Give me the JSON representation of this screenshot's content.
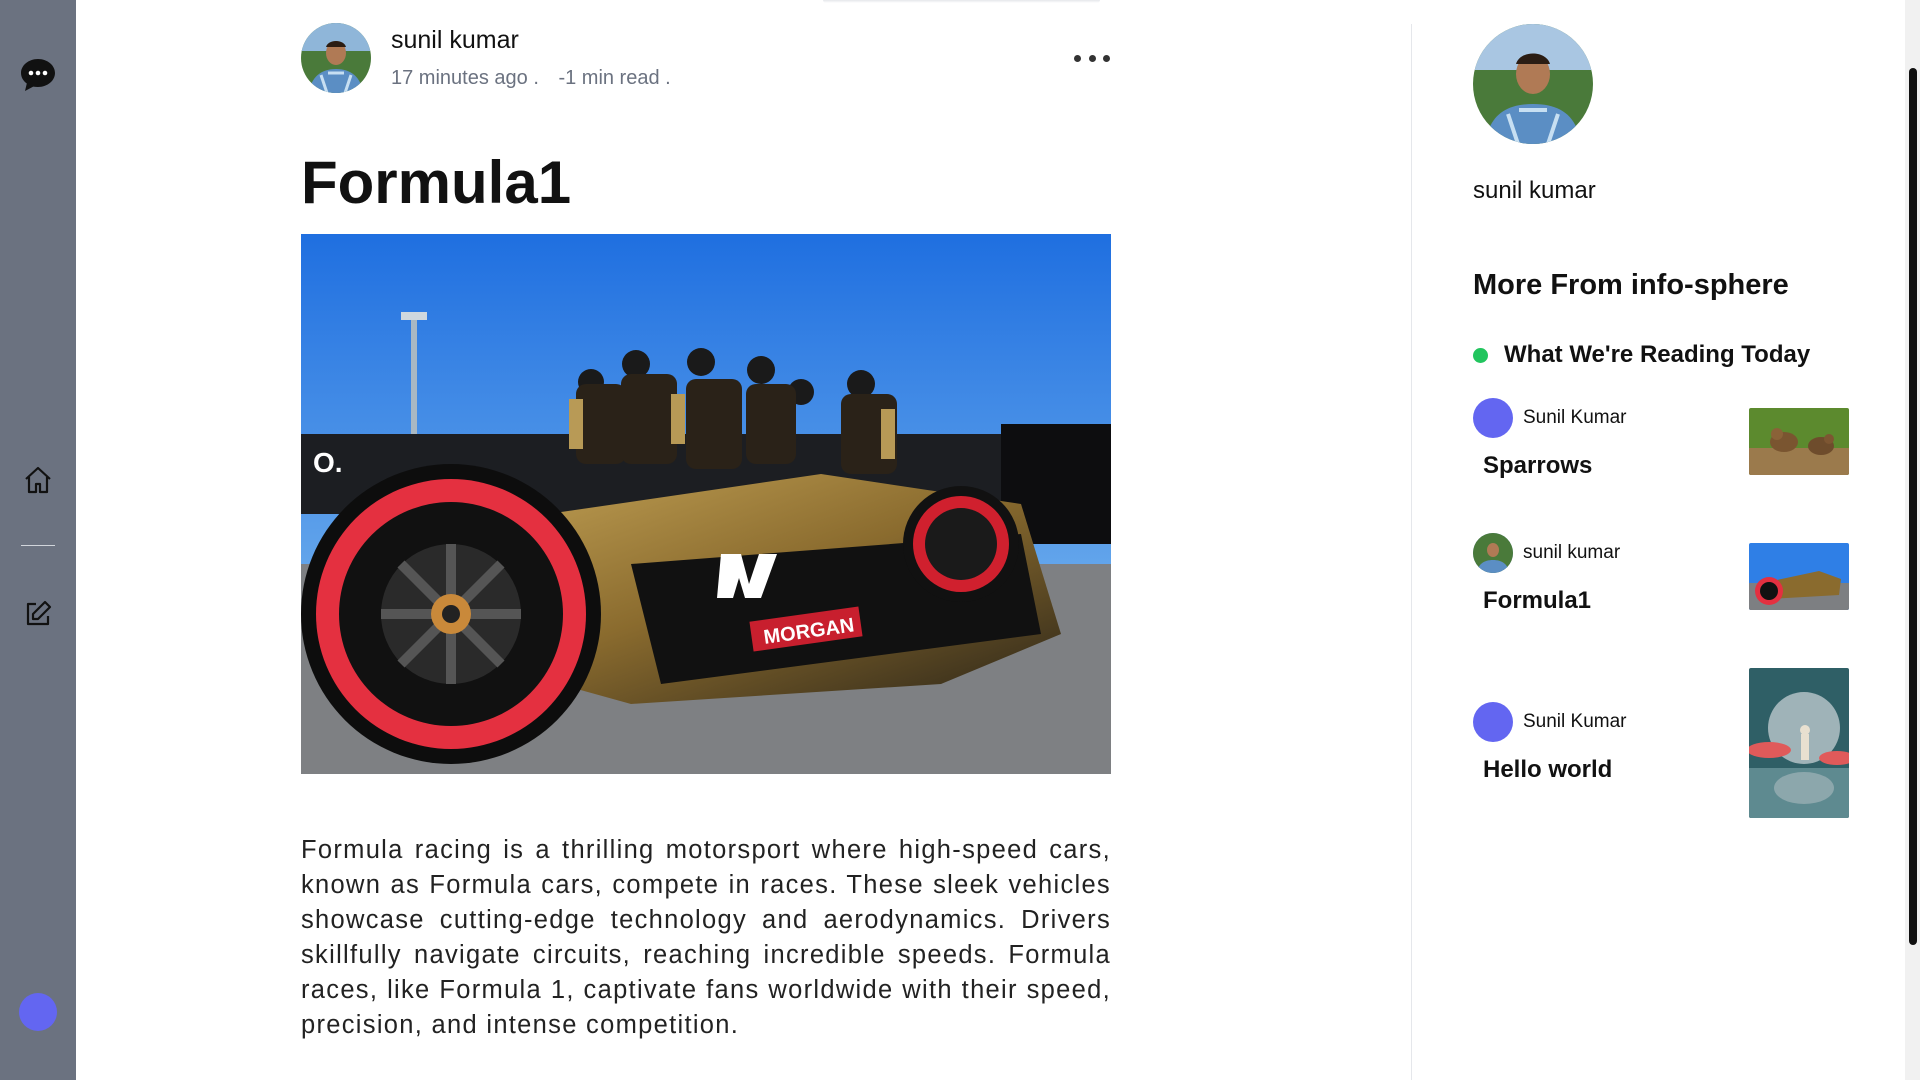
{
  "rail": {
    "icons": [
      "chat-icon",
      "home-icon",
      "edit-icon"
    ]
  },
  "article": {
    "author_name": "sunil kumar",
    "time_ago": "17 minutes ago .",
    "read_time": "-1 min read .",
    "title": "Formula1",
    "body": "Formula racing is a thrilling motorsport where high-speed cars, known as Formula cars, compete in races. These sleek vehicles showcase cutting-edge technology and aerodynamics. Drivers skillfully navigate circuits, reaching incredible speeds. Formula races, like Formula 1, captivate fans worldwide with their speed, precision, and intense competition."
  },
  "sidebar": {
    "profile_name": "sunil kumar",
    "heading": "More From info-sphere",
    "section_label": "What We're Reading Today",
    "cards": [
      {
        "author": "Sunil Kumar",
        "title": "Sparrows"
      },
      {
        "author": "sunil kumar",
        "title": "Formula1"
      },
      {
        "author": "Sunil Kumar",
        "title": "Hello world"
      }
    ]
  },
  "colors": {
    "rail": "#6b7280",
    "accent": "#6366f1",
    "status_dot": "#22c55e"
  }
}
